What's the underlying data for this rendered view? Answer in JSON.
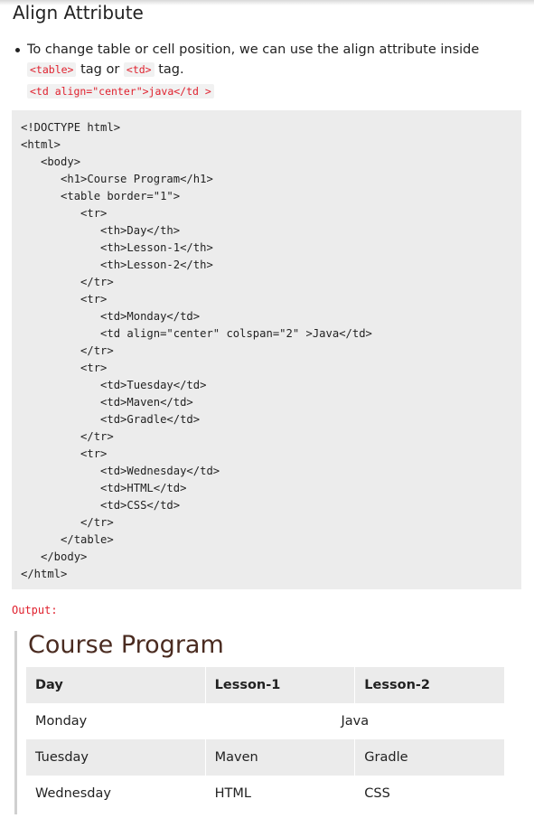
{
  "heading": "Align Attribute",
  "bullet": {
    "text_1": "To change table or cell position, we can use the align attribute inside ",
    "code_table": "<table>",
    "text_2": " tag or ",
    "code_td": "<td>",
    "text_3": " tag."
  },
  "example_code": "<td align=\"center\">java</td >",
  "code_lines": [
    "<!DOCTYPE html>",
    "<html>",
    "   <body>",
    "      <h1>Course Program</h1>",
    "      <table border=\"1\">",
    "         <tr>",
    "            <th>Day</th>",
    "            <th>Lesson-1</th>",
    "            <th>Lesson-2</th>",
    "         </tr>",
    "         <tr>",
    "            <td>Monday</td>",
    "            <td align=\"center\" colspan=\"2\" >Java</td>",
    "         </tr>",
    "         <tr>",
    "            <td>Tuesday</td>",
    "            <td>Maven</td>",
    "            <td>Gradle</td>",
    "         </tr>",
    "         <tr>",
    "            <td>Wednesday</td>",
    "            <td>HTML</td>",
    "            <td>CSS</td>",
    "         </tr>",
    "      </table>",
    "   </body>",
    "</html>"
  ],
  "output_label": "Output:",
  "output": {
    "title": "Course Program",
    "headers": [
      "Day",
      "Lesson-1",
      "Lesson-2"
    ],
    "rows": [
      [
        "Monday",
        "Java"
      ],
      [
        "Tuesday",
        "Maven",
        "Gradle"
      ],
      [
        "Wednesday",
        "HTML",
        "CSS"
      ]
    ]
  },
  "colors": {
    "inline_code": "#e0212e",
    "code_background": "#ececec",
    "output_title": "#4a2b20"
  }
}
